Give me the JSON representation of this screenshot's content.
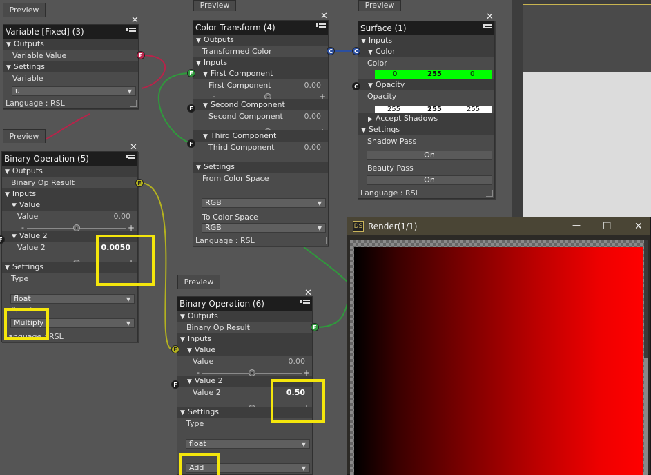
{
  "preview_label": "Preview",
  "colors": {
    "highlight": "#f4e60c",
    "wire_red": "#b8234a",
    "wire_green": "#2f9a3c",
    "wire_yellow": "#b4b21f",
    "wire_blue": "#2b4fa0",
    "color_green": "#00ff00"
  },
  "node_variable": {
    "title": "Variable [Fixed] (3)",
    "outputs": "Outputs",
    "output_name": "Variable Value",
    "output_port": "F",
    "settings": "Settings",
    "setting_label": "Variable",
    "setting_value": "u",
    "language": "Language : RSL"
  },
  "node_binop5": {
    "title": "Binary Operation (5)",
    "outputs": "Outputs",
    "output_name": "Binary Op Result",
    "output_port": "F",
    "inputs": "Inputs",
    "value_section": "Value",
    "value_label": "Value",
    "value_num": "0.00",
    "value2_section": "Value 2",
    "value2_label": "Value 2",
    "value2_num": "0.0050",
    "value2_port": "F",
    "settings": "Settings",
    "type_label": "Type",
    "type_value": "float",
    "operation_label": "Operation",
    "operation_value": "Multiply",
    "language": "Language : RSL"
  },
  "node_colortransform": {
    "title": "Color Transform (4)",
    "outputs": "Outputs",
    "output_name": "Transformed Color",
    "output_port": "C",
    "inputs": "Inputs",
    "first_section": "First Component",
    "first_label": "First Component",
    "first_num": "0.00",
    "first_port": "F",
    "second_section": "Second Component",
    "second_label": "Second Component",
    "second_num": "0.00",
    "second_port": "F",
    "third_section": "Third Component",
    "third_label": "Third Component",
    "third_num": "0.00",
    "third_port": "F",
    "settings": "Settings",
    "from_label": "From Color Space",
    "from_value": "RGB",
    "to_label": "To Color Space",
    "to_value": "RGB",
    "language": "Language : RSL"
  },
  "node_surface": {
    "title": "Surface (1)",
    "inputs": "Inputs",
    "color_section": "Color",
    "color_port": "C",
    "color_label": "Color",
    "color_r": "0",
    "color_g": "255",
    "color_b": "0",
    "opacity_section": "Opacity",
    "opacity_port": "C",
    "opacity_label": "Opacity",
    "opacity_r": "255",
    "opacity_g": "255",
    "opacity_b": "255",
    "accept_shadows": "Accept Shadows",
    "settings": "Settings",
    "shadow_pass_label": "Shadow Pass",
    "shadow_pass_value": "On",
    "beauty_pass_label": "Beauty Pass",
    "beauty_pass_value": "On",
    "language": "Language : RSL"
  },
  "node_binop6": {
    "title": "Binary Operation (6)",
    "outputs": "Outputs",
    "output_name": "Binary Op Result",
    "output_port": "F",
    "inputs": "Inputs",
    "value_section": "Value",
    "value_port": "F",
    "value_label": "Value",
    "value_num": "0.00",
    "value2_section": "Value 2",
    "value2_port": "F",
    "value2_label": "Value 2",
    "value2_num": "0.50",
    "settings": "Settings",
    "type_label": "Type",
    "type_value": "float",
    "operation_value": "Add"
  },
  "render_window": {
    "logo": "DS",
    "title": "Render(1/1)",
    "minimize": "—",
    "maximize": "☐",
    "close": "✕"
  }
}
